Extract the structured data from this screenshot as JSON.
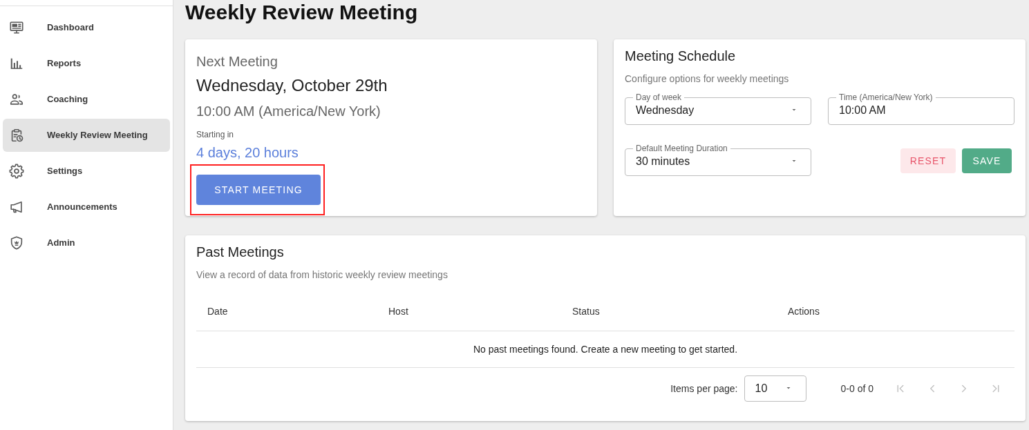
{
  "sidebar": {
    "items": [
      {
        "label": "Dashboard",
        "selected": false
      },
      {
        "label": "Reports",
        "selected": false
      },
      {
        "label": "Coaching",
        "selected": false
      },
      {
        "label": "Weekly Review Meeting",
        "selected": true
      },
      {
        "label": "Settings",
        "selected": false
      },
      {
        "label": "Announcements",
        "selected": false
      },
      {
        "label": "Admin",
        "selected": false
      }
    ]
  },
  "page": {
    "title": "Weekly Review Meeting"
  },
  "next_meeting": {
    "heading": "Next Meeting",
    "date": "Wednesday, October 29th",
    "time": "10:00 AM (America/New York)",
    "countdown_label": "Starting in",
    "countdown": "4 days, 20 hours",
    "button": {
      "label": "START MEETING",
      "highlighted": true
    }
  },
  "meeting_schedule": {
    "title": "Meeting Schedule",
    "subtitle": "Configure options for weekly meetings",
    "fields": [
      {
        "kind": "select",
        "label": "Day of week",
        "value": "Wednesday"
      },
      {
        "kind": "text",
        "label": "Time (America/New York)",
        "value": "10:00 AM"
      },
      {
        "kind": "select",
        "label": "Default Meeting Duration",
        "value": "30 minutes"
      }
    ],
    "buttons": [
      {
        "kind": "reset",
        "label": "RESET"
      },
      {
        "kind": "save",
        "label": "SAVE"
      }
    ]
  },
  "past_meetings": {
    "title": "Past Meetings",
    "subtitle": "View a record of data from historic weekly review meetings",
    "table": {
      "columns": [
        "Date",
        "Host",
        "Status",
        "Actions"
      ],
      "empty_message": "No past meetings found. Create a new meeting to get started."
    },
    "pagination": {
      "label": "Items per page:",
      "page_size": "10",
      "range": "0-0 of 0",
      "nav": [
        {
          "kind": "first",
          "disabled": true
        },
        {
          "kind": "previous",
          "disabled": true
        },
        {
          "kind": "next",
          "disabled": true
        },
        {
          "kind": "last",
          "disabled": true
        }
      ]
    }
  }
}
